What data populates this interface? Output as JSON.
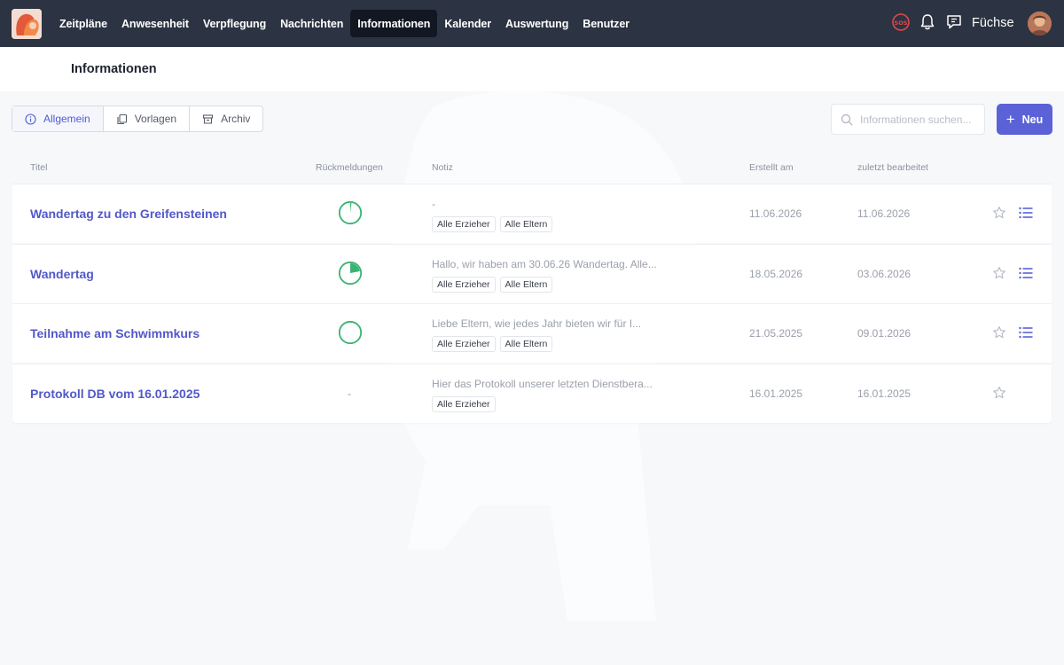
{
  "nav": {
    "items": [
      "Zeitpläne",
      "Anwesenheit",
      "Verpflegung",
      "Nachrichten",
      "Informationen",
      "Kalender",
      "Auswertung",
      "Benutzer"
    ],
    "active": "Informationen",
    "group_name": "Füchse",
    "sos_label": "SOS"
  },
  "page": {
    "title": "Informationen"
  },
  "tabs": [
    {
      "label": "Allgemein",
      "icon": "info-circle-icon"
    },
    {
      "label": "Vorlagen",
      "icon": "copy-icon"
    },
    {
      "label": "Archiv",
      "icon": "archive-box-icon"
    }
  ],
  "active_tab": "Allgemein",
  "search": {
    "placeholder": "Informationen suchen..."
  },
  "new_button": {
    "label": "Neu"
  },
  "table": {
    "headers": {
      "title": "Titel",
      "responses": "Rückmeldungen",
      "note": "Notiz",
      "created": "Erstellt am",
      "edited": "zuletzt bearbeitet"
    },
    "rows": [
      {
        "title": "Wandertag zu den Greifensteinen",
        "response_fraction": 0.02,
        "note": "-",
        "tags": [
          "Alle Erzieher",
          "Alle Eltern"
        ],
        "created": "11.06.2026",
        "edited": "11.06.2026",
        "has_list": true
      },
      {
        "title": "Wandertag",
        "response_fraction": 0.22,
        "note": "Hallo, wir haben am 30.06.26 Wandertag. Alle...",
        "tags": [
          "Alle Erzieher",
          "Alle Eltern"
        ],
        "created": "18.05.2026",
        "edited": "03.06.2026",
        "has_list": true
      },
      {
        "title": "Teilnahme am Schwimmkurs",
        "response_fraction": 0,
        "note": "Liebe Eltern, wie jedes Jahr bieten wir für I...",
        "tags": [
          "Alle Erzieher",
          "Alle Eltern"
        ],
        "created": "21.05.2025",
        "edited": "09.01.2026",
        "has_list": true
      },
      {
        "title": "Protokoll DB vom 16.01.2025",
        "response_text": "-",
        "note": "Hier das Protokoll unserer letzten Dienstbera...",
        "tags": [
          "Alle Erzieher"
        ],
        "created": "16.01.2025",
        "edited": "16.01.2025",
        "has_list": false
      }
    ]
  },
  "colors": {
    "topbar": "#2c3342",
    "accent": "#5b62d8",
    "link": "#5258c9",
    "progress": "#3bb273"
  }
}
